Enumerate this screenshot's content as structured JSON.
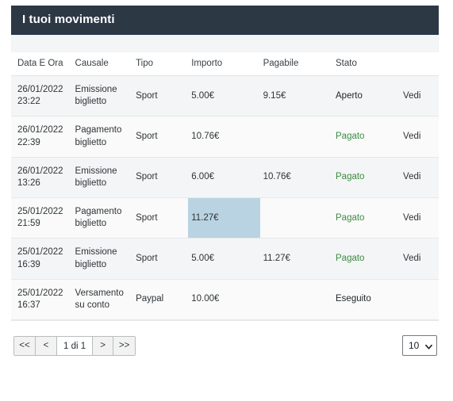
{
  "header": {
    "title": "I tuoi movimenti"
  },
  "table": {
    "columns": [
      {
        "key": "date",
        "label": "Data E Ora"
      },
      {
        "key": "cause",
        "label": "Causale"
      },
      {
        "key": "type",
        "label": "Tipo"
      },
      {
        "key": "amount",
        "label": "Importo"
      },
      {
        "key": "payable",
        "label": "Pagabile"
      },
      {
        "key": "state",
        "label": "Stato"
      },
      {
        "key": "action",
        "label": ""
      }
    ],
    "rows": [
      {
        "date": "26/01/2022 23:22",
        "cause": "Emissione biglietto",
        "type": "Sport",
        "amount": "5.00€",
        "payable": "9.15€",
        "state": "Aperto",
        "state_style": "plain",
        "action": "Vedi",
        "selected_cell": ""
      },
      {
        "date": "26/01/2022 22:39",
        "cause": "Pagamento biglietto",
        "type": "Sport",
        "amount": "10.76€",
        "payable": "",
        "state": "Pagato",
        "state_style": "paid",
        "action": "Vedi",
        "selected_cell": ""
      },
      {
        "date": "26/01/2022 13:26",
        "cause": "Emissione biglietto",
        "type": "Sport",
        "amount": "6.00€",
        "payable": "10.76€",
        "state": "Pagato",
        "state_style": "paid",
        "action": "Vedi",
        "selected_cell": ""
      },
      {
        "date": "25/01/2022 21:59",
        "cause": "Pagamento biglietto",
        "type": "Sport",
        "amount": "11.27€",
        "payable": "",
        "state": "Pagato",
        "state_style": "paid",
        "action": "Vedi",
        "selected_cell": "amount"
      },
      {
        "date": "25/01/2022 16:39",
        "cause": "Emissione biglietto",
        "type": "Sport",
        "amount": "5.00€",
        "payable": "11.27€",
        "state": "Pagato",
        "state_style": "paid",
        "action": "Vedi",
        "selected_cell": ""
      },
      {
        "date": "25/01/2022 16:37",
        "cause": "Versamento su conto",
        "type": "Paypal",
        "amount": "10.00€",
        "payable": "",
        "state": "Eseguito",
        "state_style": "plain",
        "action": "",
        "selected_cell": ""
      }
    ]
  },
  "pagination": {
    "first_label": "<<",
    "prev_label": "<",
    "page_label": "1 di 1",
    "next_label": ">",
    "last_label": ">>",
    "page_size": "10",
    "page_size_icon": "chevron-down-icon"
  },
  "colors": {
    "header_bg": "#2d3845",
    "header_rule": "#28384a",
    "selected_cell": "#b9d3e2",
    "status_paid": "#3d8b42",
    "row_odd": "#f4f5f6",
    "row_even": "#fafafa"
  }
}
